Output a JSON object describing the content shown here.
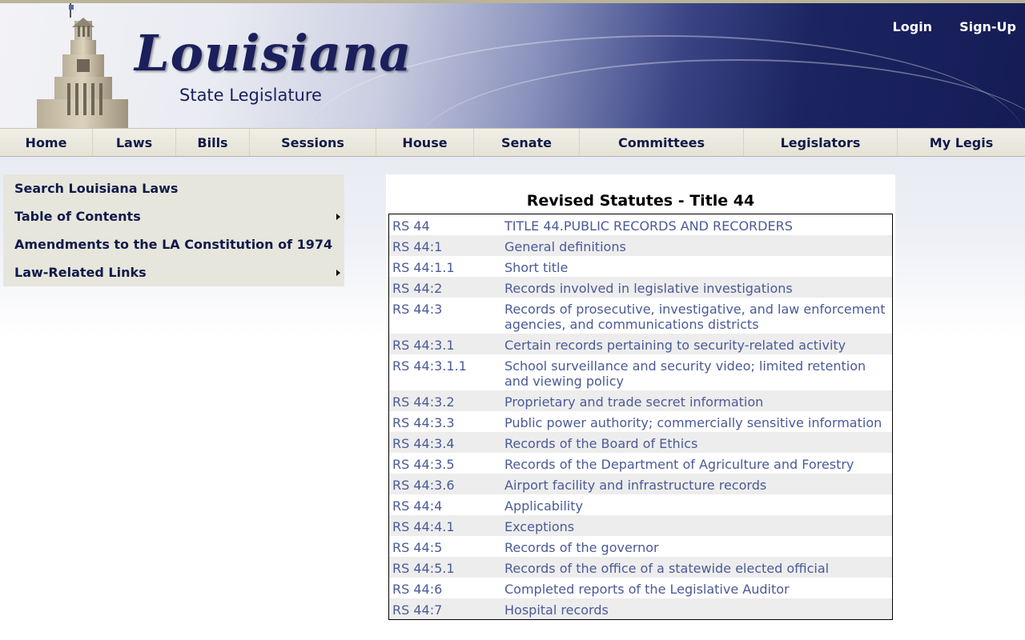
{
  "header": {
    "logo_title": "Louisiana",
    "logo_subtitle": "State Legislature",
    "login_label": "Login",
    "signup_label": "Sign-Up"
  },
  "nav": {
    "items": [
      {
        "label": "Home"
      },
      {
        "label": "Laws"
      },
      {
        "label": "Bills"
      },
      {
        "label": "Sessions"
      },
      {
        "label": "House"
      },
      {
        "label": "Senate"
      },
      {
        "label": "Committees"
      },
      {
        "label": "Legislators"
      },
      {
        "label": "My Legis"
      }
    ]
  },
  "sidebar": {
    "items": [
      {
        "label": "Search Louisiana Laws",
        "has_submenu": false
      },
      {
        "label": "Table of Contents",
        "has_submenu": true
      },
      {
        "label": "Amendments to the LA Constitution of 1974",
        "has_submenu": false
      },
      {
        "label": "Law-Related Links",
        "has_submenu": true
      }
    ]
  },
  "content": {
    "title": "Revised Statutes - Title 44",
    "rows": [
      {
        "rs": "RS 44",
        "desc": "TITLE 44.PUBLIC RECORDS AND RECORDERS"
      },
      {
        "rs": "RS 44:1",
        "desc": "General definitions"
      },
      {
        "rs": "RS 44:1.1",
        "desc": "Short title"
      },
      {
        "rs": "RS 44:2",
        "desc": "Records involved in legislative investigations"
      },
      {
        "rs": "RS 44:3",
        "desc": "Records of prosecutive, investigative, and law enforcement agencies, and communications districts"
      },
      {
        "rs": "RS 44:3.1",
        "desc": "Certain records pertaining to security-related activity"
      },
      {
        "rs": "RS 44:3.1.1",
        "desc": "School surveillance and security video; limited retention and viewing policy"
      },
      {
        "rs": "RS 44:3.2",
        "desc": "Proprietary and trade secret information"
      },
      {
        "rs": "RS 44:3.3",
        "desc": "Public power authority; commercially sensitive information"
      },
      {
        "rs": "RS 44:3.4",
        "desc": "Records of the Board of Ethics"
      },
      {
        "rs": "RS 44:3.5",
        "desc": "Records of the Department of Agriculture and Forestry"
      },
      {
        "rs": "RS 44:3.6",
        "desc": "Airport facility and infrastructure records"
      },
      {
        "rs": "RS 44:4",
        "desc": "Applicability"
      },
      {
        "rs": "RS 44:4.1",
        "desc": "Exceptions"
      },
      {
        "rs": "RS 44:5",
        "desc": "Records of the governor"
      },
      {
        "rs": "RS 44:5.1",
        "desc": "Records of the office of a statewide elected official"
      },
      {
        "rs": "RS 44:6",
        "desc": "Completed reports of the Legislative Auditor"
      },
      {
        "rs": "RS 44:7",
        "desc": "Hospital records"
      }
    ]
  },
  "colors": {
    "brand_navy": "#1b1f5c",
    "nav_text": "#101a4a",
    "link": "#4b5a98",
    "row_alt": "#ededed"
  }
}
